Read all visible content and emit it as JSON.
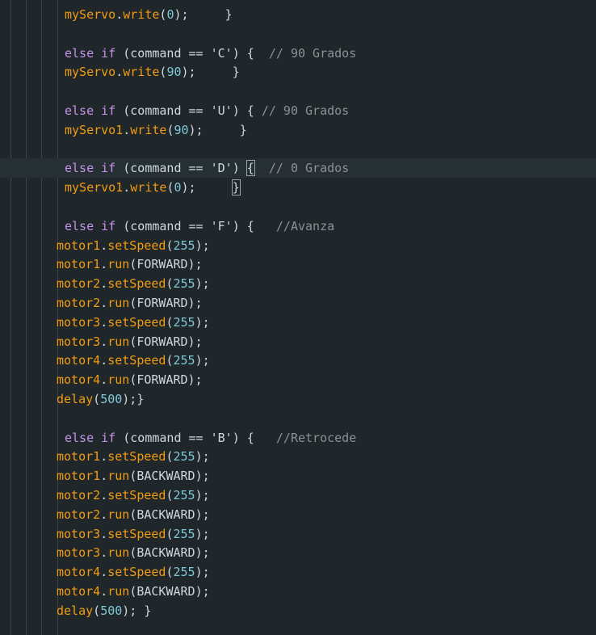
{
  "code_lines": [
    {
      "indent": 10,
      "tokens": [
        {
          "t": "obj",
          "v": "myServo"
        },
        {
          "t": "op",
          "v": "."
        },
        {
          "t": "fn",
          "v": "write"
        },
        {
          "t": "op",
          "v": "("
        },
        {
          "t": "num",
          "v": "0"
        },
        {
          "t": "op",
          "v": ");     }"
        }
      ]
    },
    {
      "indent": 10,
      "tokens": []
    },
    {
      "indent": 10,
      "tokens": [
        {
          "t": "kw",
          "v": "else if"
        },
        {
          "t": "op",
          "v": " (command == "
        },
        {
          "t": "str",
          "v": "'C'"
        },
        {
          "t": "op",
          "v": ") {  "
        },
        {
          "t": "cm",
          "v": "// 90 Grados"
        }
      ]
    },
    {
      "indent": 10,
      "tokens": [
        {
          "t": "obj",
          "v": "myServo"
        },
        {
          "t": "op",
          "v": "."
        },
        {
          "t": "fn",
          "v": "write"
        },
        {
          "t": "op",
          "v": "("
        },
        {
          "t": "num",
          "v": "90"
        },
        {
          "t": "op",
          "v": ");     }"
        }
      ]
    },
    {
      "indent": 10,
      "tokens": []
    },
    {
      "indent": 10,
      "tokens": [
        {
          "t": "kw",
          "v": "else if"
        },
        {
          "t": "op",
          "v": " (command == "
        },
        {
          "t": "str",
          "v": "'U'"
        },
        {
          "t": "op",
          "v": ") { "
        },
        {
          "t": "cm",
          "v": "// 90 Grados"
        }
      ]
    },
    {
      "indent": 10,
      "tokens": [
        {
          "t": "obj",
          "v": "myServo1"
        },
        {
          "t": "op",
          "v": "."
        },
        {
          "t": "fn",
          "v": "write"
        },
        {
          "t": "op",
          "v": "("
        },
        {
          "t": "num",
          "v": "90"
        },
        {
          "t": "op",
          "v": ");     }"
        }
      ]
    },
    {
      "indent": 10,
      "tokens": []
    },
    {
      "indent": 10,
      "active": true,
      "tokens": [
        {
          "t": "kw",
          "v": "else if"
        },
        {
          "t": "op",
          "v": " (command == "
        },
        {
          "t": "str",
          "v": "'D'"
        },
        {
          "t": "op",
          "v": ") "
        },
        {
          "t": "bracehl",
          "v": "{"
        },
        {
          "t": "op",
          "v": "  "
        },
        {
          "t": "cm",
          "v": "// 0 Grados"
        }
      ]
    },
    {
      "indent": 10,
      "tokens": [
        {
          "t": "obj",
          "v": "myServo1"
        },
        {
          "t": "op",
          "v": "."
        },
        {
          "t": "fn",
          "v": "write"
        },
        {
          "t": "op",
          "v": "("
        },
        {
          "t": "num",
          "v": "0"
        },
        {
          "t": "op",
          "v": ");     "
        },
        {
          "t": "bracehl",
          "v": "}"
        }
      ]
    },
    {
      "indent": 10,
      "tokens": []
    },
    {
      "indent": 10,
      "tokens": [
        {
          "t": "kw",
          "v": "else if"
        },
        {
          "t": "op",
          "v": " (command == "
        },
        {
          "t": "str",
          "v": "'F'"
        },
        {
          "t": "op",
          "v": ") {   "
        },
        {
          "t": "cm",
          "v": "//Avanza"
        }
      ]
    },
    {
      "indent": 0,
      "tokens": [
        {
          "t": "obj",
          "v": "motor1"
        },
        {
          "t": "op",
          "v": "."
        },
        {
          "t": "fn",
          "v": "setSpeed"
        },
        {
          "t": "op",
          "v": "("
        },
        {
          "t": "num",
          "v": "255"
        },
        {
          "t": "op",
          "v": ");"
        }
      ]
    },
    {
      "indent": 0,
      "tokens": [
        {
          "t": "obj",
          "v": "motor1"
        },
        {
          "t": "op",
          "v": "."
        },
        {
          "t": "fn",
          "v": "run"
        },
        {
          "t": "op",
          "v": "(FORWARD);"
        }
      ]
    },
    {
      "indent": 0,
      "tokens": [
        {
          "t": "obj",
          "v": "motor2"
        },
        {
          "t": "op",
          "v": "."
        },
        {
          "t": "fn",
          "v": "setSpeed"
        },
        {
          "t": "op",
          "v": "("
        },
        {
          "t": "num",
          "v": "255"
        },
        {
          "t": "op",
          "v": ");"
        }
      ]
    },
    {
      "indent": 0,
      "tokens": [
        {
          "t": "obj",
          "v": "motor2"
        },
        {
          "t": "op",
          "v": "."
        },
        {
          "t": "fn",
          "v": "run"
        },
        {
          "t": "op",
          "v": "(FORWARD);"
        }
      ]
    },
    {
      "indent": 0,
      "tokens": [
        {
          "t": "obj",
          "v": "motor3"
        },
        {
          "t": "op",
          "v": "."
        },
        {
          "t": "fn",
          "v": "setSpeed"
        },
        {
          "t": "op",
          "v": "("
        },
        {
          "t": "num",
          "v": "255"
        },
        {
          "t": "op",
          "v": ");"
        }
      ]
    },
    {
      "indent": 0,
      "tokens": [
        {
          "t": "obj",
          "v": "motor3"
        },
        {
          "t": "op",
          "v": "."
        },
        {
          "t": "fn",
          "v": "run"
        },
        {
          "t": "op",
          "v": "(FORWARD);"
        }
      ]
    },
    {
      "indent": 0,
      "tokens": [
        {
          "t": "obj",
          "v": "motor4"
        },
        {
          "t": "op",
          "v": "."
        },
        {
          "t": "fn",
          "v": "setSpeed"
        },
        {
          "t": "op",
          "v": "("
        },
        {
          "t": "num",
          "v": "255"
        },
        {
          "t": "op",
          "v": ");"
        }
      ]
    },
    {
      "indent": 0,
      "tokens": [
        {
          "t": "obj",
          "v": "motor4"
        },
        {
          "t": "op",
          "v": "."
        },
        {
          "t": "fn",
          "v": "run"
        },
        {
          "t": "op",
          "v": "(FORWARD);"
        }
      ]
    },
    {
      "indent": 0,
      "tokens": [
        {
          "t": "fn",
          "v": "delay"
        },
        {
          "t": "op",
          "v": "("
        },
        {
          "t": "num",
          "v": "500"
        },
        {
          "t": "op",
          "v": ");}"
        }
      ]
    },
    {
      "indent": 10,
      "tokens": []
    },
    {
      "indent": 10,
      "tokens": [
        {
          "t": "kw",
          "v": "else if"
        },
        {
          "t": "op",
          "v": " (command == "
        },
        {
          "t": "str",
          "v": "'B'"
        },
        {
          "t": "op",
          "v": ") {   "
        },
        {
          "t": "cm",
          "v": "//Retrocede"
        }
      ]
    },
    {
      "indent": 0,
      "tokens": [
        {
          "t": "obj",
          "v": "motor1"
        },
        {
          "t": "op",
          "v": "."
        },
        {
          "t": "fn",
          "v": "setSpeed"
        },
        {
          "t": "op",
          "v": "("
        },
        {
          "t": "num",
          "v": "255"
        },
        {
          "t": "op",
          "v": ");"
        }
      ]
    },
    {
      "indent": 0,
      "tokens": [
        {
          "t": "obj",
          "v": "motor1"
        },
        {
          "t": "op",
          "v": "."
        },
        {
          "t": "fn",
          "v": "run"
        },
        {
          "t": "op",
          "v": "(BACKWARD);"
        }
      ]
    },
    {
      "indent": 0,
      "tokens": [
        {
          "t": "obj",
          "v": "motor2"
        },
        {
          "t": "op",
          "v": "."
        },
        {
          "t": "fn",
          "v": "setSpeed"
        },
        {
          "t": "op",
          "v": "("
        },
        {
          "t": "num",
          "v": "255"
        },
        {
          "t": "op",
          "v": ");"
        }
      ]
    },
    {
      "indent": 0,
      "tokens": [
        {
          "t": "obj",
          "v": "motor2"
        },
        {
          "t": "op",
          "v": "."
        },
        {
          "t": "fn",
          "v": "run"
        },
        {
          "t": "op",
          "v": "(BACKWARD);"
        }
      ]
    },
    {
      "indent": 0,
      "tokens": [
        {
          "t": "obj",
          "v": "motor3"
        },
        {
          "t": "op",
          "v": "."
        },
        {
          "t": "fn",
          "v": "setSpeed"
        },
        {
          "t": "op",
          "v": "("
        },
        {
          "t": "num",
          "v": "255"
        },
        {
          "t": "op",
          "v": ");"
        }
      ]
    },
    {
      "indent": 0,
      "tokens": [
        {
          "t": "obj",
          "v": "motor3"
        },
        {
          "t": "op",
          "v": "."
        },
        {
          "t": "fn",
          "v": "run"
        },
        {
          "t": "op",
          "v": "(BACKWARD);"
        }
      ]
    },
    {
      "indent": 0,
      "tokens": [
        {
          "t": "obj",
          "v": "motor4"
        },
        {
          "t": "op",
          "v": "."
        },
        {
          "t": "fn",
          "v": "setSpeed"
        },
        {
          "t": "op",
          "v": "("
        },
        {
          "t": "num",
          "v": "255"
        },
        {
          "t": "op",
          "v": ");"
        }
      ]
    },
    {
      "indent": 0,
      "tokens": [
        {
          "t": "obj",
          "v": "motor4"
        },
        {
          "t": "op",
          "v": "."
        },
        {
          "t": "fn",
          "v": "run"
        },
        {
          "t": "op",
          "v": "(BACKWARD);"
        }
      ]
    },
    {
      "indent": 0,
      "tokens": [
        {
          "t": "fn",
          "v": "delay"
        },
        {
          "t": "op",
          "v": "("
        },
        {
          "t": "num",
          "v": "500"
        },
        {
          "t": "op",
          "v": "); }"
        }
      ]
    }
  ],
  "colors": {
    "background": "#1f272a",
    "object": "#f39c12",
    "keyword": "#c792ea",
    "number": "#7fc9d8",
    "comment": "#8a9296",
    "text": "#cfd8dc"
  }
}
